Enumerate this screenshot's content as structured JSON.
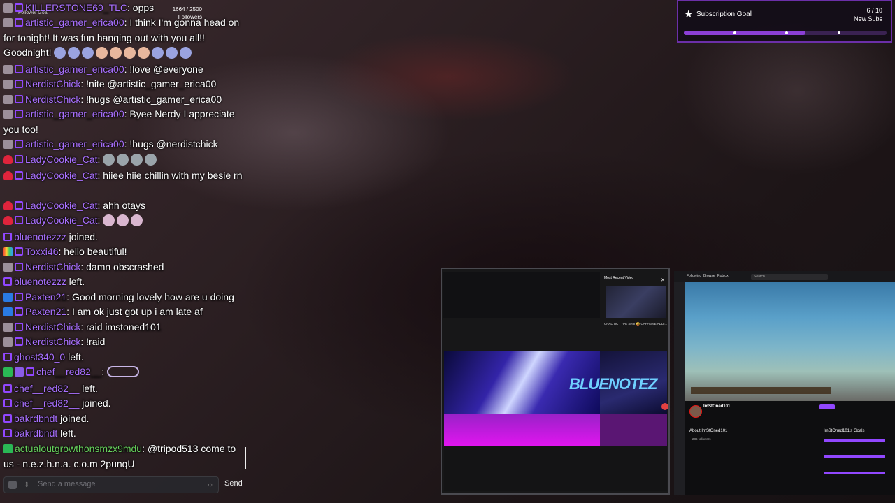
{
  "follower_goal": {
    "title": "Follower Goal",
    "count": "1664 / 2500",
    "unit": "Followers"
  },
  "subscription_goal": {
    "title": "Subscription Goal",
    "count": "6 / 10",
    "unit": "New Subs",
    "progress": 0.6
  },
  "chat": {
    "messages": [
      {
        "user": "KILLERSTONE69_TLC",
        "text": ": opps"
      },
      {
        "user": "artistic_gamer_erica00",
        "text": ": I think I'm gonna head on for tonight! It was fun hanging out with you all!! Goodnight!"
      },
      {
        "user": "artistic_gamer_erica00",
        "text": ": !love @everyone"
      },
      {
        "user": "NerdistChick",
        "text": ": !nite @artistic_gamer_erica00"
      },
      {
        "user": "NerdistChick",
        "text": ": !hugs @artistic_gamer_erica00"
      },
      {
        "user": "artistic_gamer_erica00",
        "text": ": Byee Nerdy I appreciate you too!"
      },
      {
        "user": "artistic_gamer_erica00",
        "text": ": !hugs @nerdistchick"
      },
      {
        "user": "LadyCookie_Cat",
        "text": ":"
      },
      {
        "user": "LadyCookie_Cat",
        "text": ": hiiee hiie chillin with my besie rn"
      },
      {
        "user": "LadyCookie_Cat",
        "text": ": ahh otays"
      },
      {
        "user": "LadyCookie_Cat",
        "text": ":"
      },
      {
        "user": "bluenotezzz",
        "text": " joined."
      },
      {
        "user": "Toxxi46",
        "text": ": hello beautiful!"
      },
      {
        "user": "NerdistChick",
        "text": ": damn obscrashed"
      },
      {
        "user": "bluenotezzz",
        "text": " left."
      },
      {
        "user": "Paxten21",
        "text": ": Good morning lovely how are u doing"
      },
      {
        "user": "Paxten21",
        "text": ": I am ok just got up i am late af"
      },
      {
        "user": "NerdistChick",
        "text": ": raid imstoned101"
      },
      {
        "user": "NerdistChick",
        "text": ": !raid"
      },
      {
        "user": "ghost340_0",
        "text": " left."
      },
      {
        "user": "chef__red82__",
        "text": ":"
      },
      {
        "user": "chef__red82__",
        "text": " left."
      },
      {
        "user": "chef__red82__",
        "text": " joined."
      },
      {
        "user": "bakrdbndt",
        "text": " joined."
      },
      {
        "user": "bakrdbndt",
        "text": " left."
      },
      {
        "user": "actualoutgrowthonsmzx9mdu",
        "text": ": @tripod513 come to us - n.e.z.h.n.a. c.o.m 2punqU"
      }
    ],
    "input_placeholder": "Send a message",
    "send_label": "Send"
  },
  "window1": {
    "most_recent_label": "Most Recent Video",
    "video_caption": "CHAOTIC TYPE SHIII 🤪 CAFFEINE ADDI...",
    "banner_text": "BLUENOTEZ"
  },
  "window2": {
    "nav": [
      "Following",
      "Browse",
      "Roblox"
    ],
    "search_placeholder": "Search",
    "channel_name": "ImStOned101",
    "about_label": "About ImStOned101",
    "followers": "286 followers",
    "goals_label": "ImStOned101's Goals"
  }
}
